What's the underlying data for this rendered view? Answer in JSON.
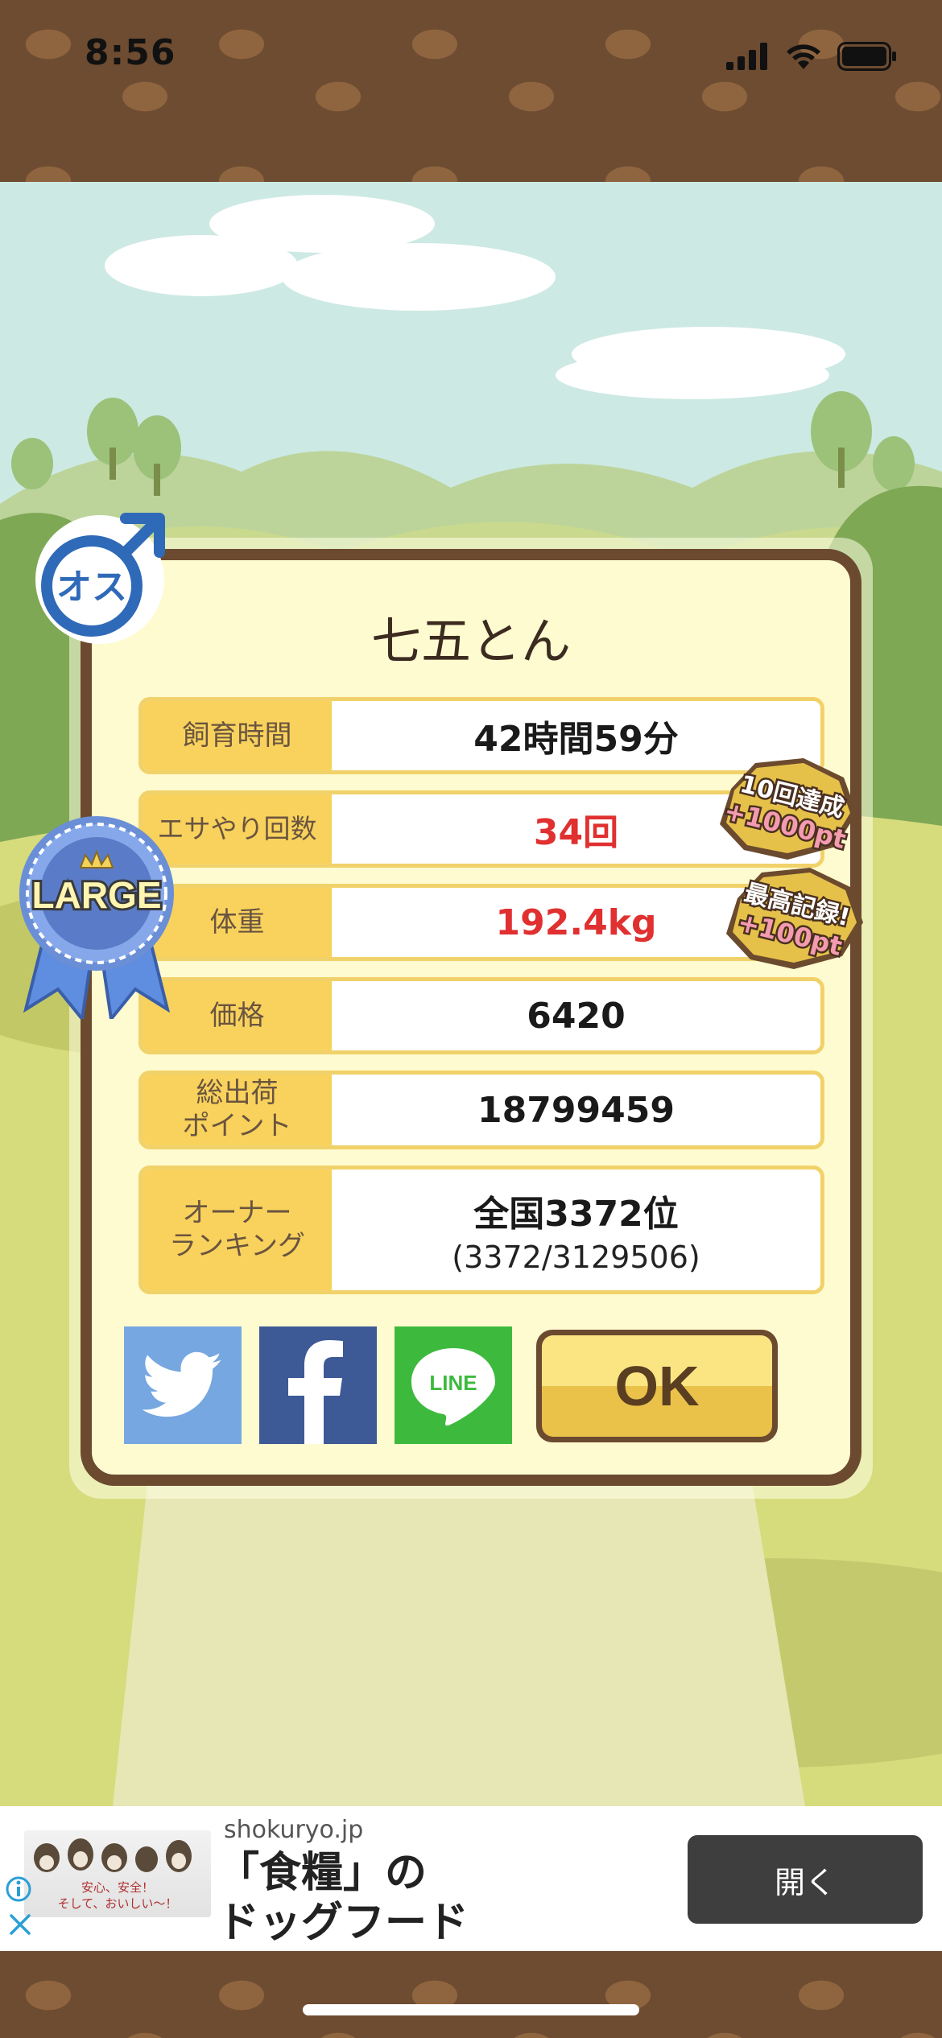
{
  "status_bar": {
    "time": "8:56"
  },
  "pig": {
    "name": "七五とん",
    "gender_label": "オス",
    "size_label": "LARGE"
  },
  "stats": {
    "rows": [
      {
        "label": "飼育時間",
        "value": "42時間59分"
      },
      {
        "label": "エサやり回数",
        "value": "34回"
      },
      {
        "label": "体重",
        "value": "192.4kg"
      },
      {
        "label": "価格",
        "value": "6420"
      },
      {
        "label": "総出荷\nポイント",
        "value": "18799459"
      },
      {
        "label": "オーナー\nランキング",
        "value": "全国3372位",
        "sub": "(3372/3129506)"
      }
    ]
  },
  "awards": [
    {
      "line1": "10回達成",
      "line2": "+1000pt"
    },
    {
      "line1": "最高記録!",
      "line2": "+100pt"
    }
  ],
  "share": {
    "twitter_icon": "twitter-bird-icon",
    "facebook_icon": "facebook-f-icon",
    "line_label": "LINE"
  },
  "ok_label": "OK",
  "ad": {
    "domain": "shokuryo.jp",
    "title": "「食糧」の\nドッグフード",
    "open_label": "開く",
    "image_text": "安心、安全！\nそして、おいしい〜！"
  },
  "colors": {
    "frame": "#6b4a30",
    "panel": "#fffbd0",
    "label_bg": "#f8d25c",
    "highlight_text": "#e03030",
    "twitter": "#76a7e0",
    "facebook": "#3d5a96",
    "line": "#3dba3d"
  }
}
